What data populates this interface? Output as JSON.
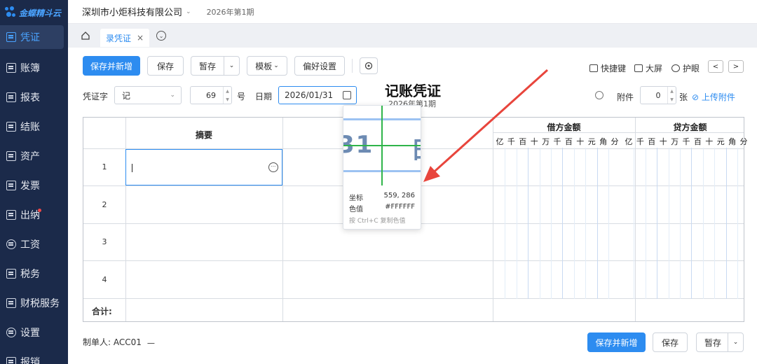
{
  "sidebar": {
    "logo": "金蝶精斗云",
    "items": [
      {
        "label": "凭证",
        "icon": "voucher-icon"
      },
      {
        "label": "账簿",
        "icon": "ledger-icon"
      },
      {
        "label": "报表",
        "icon": "report-icon"
      },
      {
        "label": "结账",
        "icon": "closing-icon"
      },
      {
        "label": "资产",
        "icon": "asset-icon"
      },
      {
        "label": "发票",
        "icon": "invoice-icon"
      },
      {
        "label": "出纳",
        "icon": "cashier-icon"
      },
      {
        "label": "工资",
        "icon": "salary-icon"
      },
      {
        "label": "税务",
        "icon": "tax-icon"
      },
      {
        "label": "财税服务",
        "icon": "service-icon"
      },
      {
        "label": "设置",
        "icon": "settings-icon"
      },
      {
        "label": "报销",
        "icon": "reimburse-icon"
      }
    ]
  },
  "topbar": {
    "company": "深圳市小炬科技有限公司",
    "period": "2026年第1期"
  },
  "tabs": [
    {
      "label": "录凭证",
      "close": "×"
    }
  ],
  "toolbar": {
    "save_new": "保存并新增",
    "save": "保存",
    "stash": "暂存",
    "template": "模板",
    "preferences": "偏好设置",
    "shortcut": "快捷键",
    "fullscreen": "大屏",
    "eye_care": "护眼",
    "prev": "<",
    "next": ">"
  },
  "form": {
    "voucher_word_label": "凭证字",
    "voucher_word": "记",
    "number": "69",
    "number_suffix": "号",
    "date_label": "日期",
    "date": "2026/01/31",
    "title": "记账凭证",
    "subtitle": "2026年第1期",
    "attachment_label": "附件",
    "attachment_count": "0",
    "attachment_unit": "张",
    "upload": "上传附件"
  },
  "table": {
    "summary_header": "摘要",
    "debit_header": "借方金额",
    "credit_header": "贷方金额",
    "digits": [
      "亿",
      "千",
      "百",
      "十",
      "万",
      "千",
      "百",
      "十",
      "元",
      "角",
      "分"
    ],
    "rows": [
      "1",
      "2",
      "3",
      "4"
    ],
    "total_label": "合计:"
  },
  "footer": {
    "maker_label": "制单人:",
    "maker": "ACC01",
    "save_new": "保存并新增",
    "save": "保存",
    "stash": "暂存"
  },
  "magnifier": {
    "zoom_text_left": "31",
    "zoom_text_right": "日",
    "coord_label": "坐标",
    "coord_value": "559, 286",
    "color_label": "色值",
    "color_value": "#FFFFFF",
    "hint": "按 Ctrl+C 复制色值"
  },
  "colors": {
    "primary": "#2d8cf0",
    "sidebar": "#1b2a4a",
    "arrow": "#e8453c",
    "crosshair": "#2fb44a"
  }
}
